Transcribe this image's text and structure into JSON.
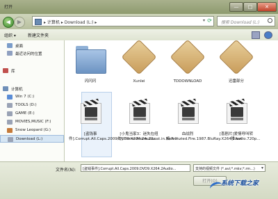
{
  "window": {
    "title": "打开",
    "controls": {
      "minimize": "—",
      "maximize": "□",
      "close": "✕"
    }
  },
  "address_bar": {
    "back_icon": "arrow-left-icon",
    "forward_icon": "arrow-right-icon",
    "path": "▸ 计算机 ▸ Download (L:) ▸",
    "search_placeholder": "搜索 Download (L:)"
  },
  "toolbar": {
    "organize": "组织 ▾",
    "new_folder": "新建文件夹"
  },
  "nav_pane": {
    "items": [
      {
        "label": "桌面",
        "icon": "desktop-icon",
        "color": "#7a9cc9"
      },
      {
        "label": "最近访问的位置",
        "icon": "recent-places-icon",
        "color": "#8fa0c0"
      },
      {
        "label": "库",
        "icon": "library-icon",
        "color": "#c0504d"
      },
      {
        "label": "计算机",
        "icon": "computer-icon",
        "color": "#6f8fb8"
      },
      {
        "label": "Win 7 (C:)",
        "icon": "drive-windows-icon",
        "color": "#5a8dd6"
      },
      {
        "label": "TOOLS (D:)",
        "icon": "drive-icon",
        "color": "#9aa3b5"
      },
      {
        "label": "GAME (E:)",
        "icon": "drive-icon",
        "color": "#9aa3b5"
      },
      {
        "label": "MOVIES,MUSIC (F:)",
        "icon": "drive-icon",
        "color": "#9aa3b5"
      },
      {
        "label": "Snow Leopard (G:)",
        "icon": "drive-icon",
        "color": "#c47a3a"
      },
      {
        "label": "Download (L:)",
        "icon": "drive-icon",
        "color": "#9aa3b5"
      }
    ],
    "selected_index": 9
  },
  "files": [
    {
      "name": "闪闪闪",
      "type": "folder-blue"
    },
    {
      "name": "Xunlei",
      "type": "folder-tan"
    },
    {
      "name": "TDDOWNLOAD",
      "type": "folder-tan"
    },
    {
      "name": "迅雷部分",
      "type": "folder-tan"
    },
    {
      "name": "[盗钱事件].Corrupt.All.Caps.2009.DVD9.X264.2Audio...",
      "type": "video"
    },
    {
      "name": "[小鬼当家3：迷失在纽约].Home.Alone.2.Lost.in.New.Y...",
      "type": "video"
    },
    {
      "name": "血战烈焰.Frenzied.Fire.1987.BluRay.X264.2Audio.720p...",
      "type": "video"
    },
    {
      "name": "[喜剧片]爱情呼叫转移.avi",
      "type": "video"
    }
  ],
  "bottom": {
    "filename_label": "文件名(N):",
    "filename_value": "[盗钱事件].Corrupt.All.Caps.2009.DVD9.X264.2Audio...",
    "filetype_value": "支持的视频文件 (*.avi;*.mkv;*.rm...)",
    "open_button": "打开(O)"
  },
  "watermark": "系统下载之家"
}
